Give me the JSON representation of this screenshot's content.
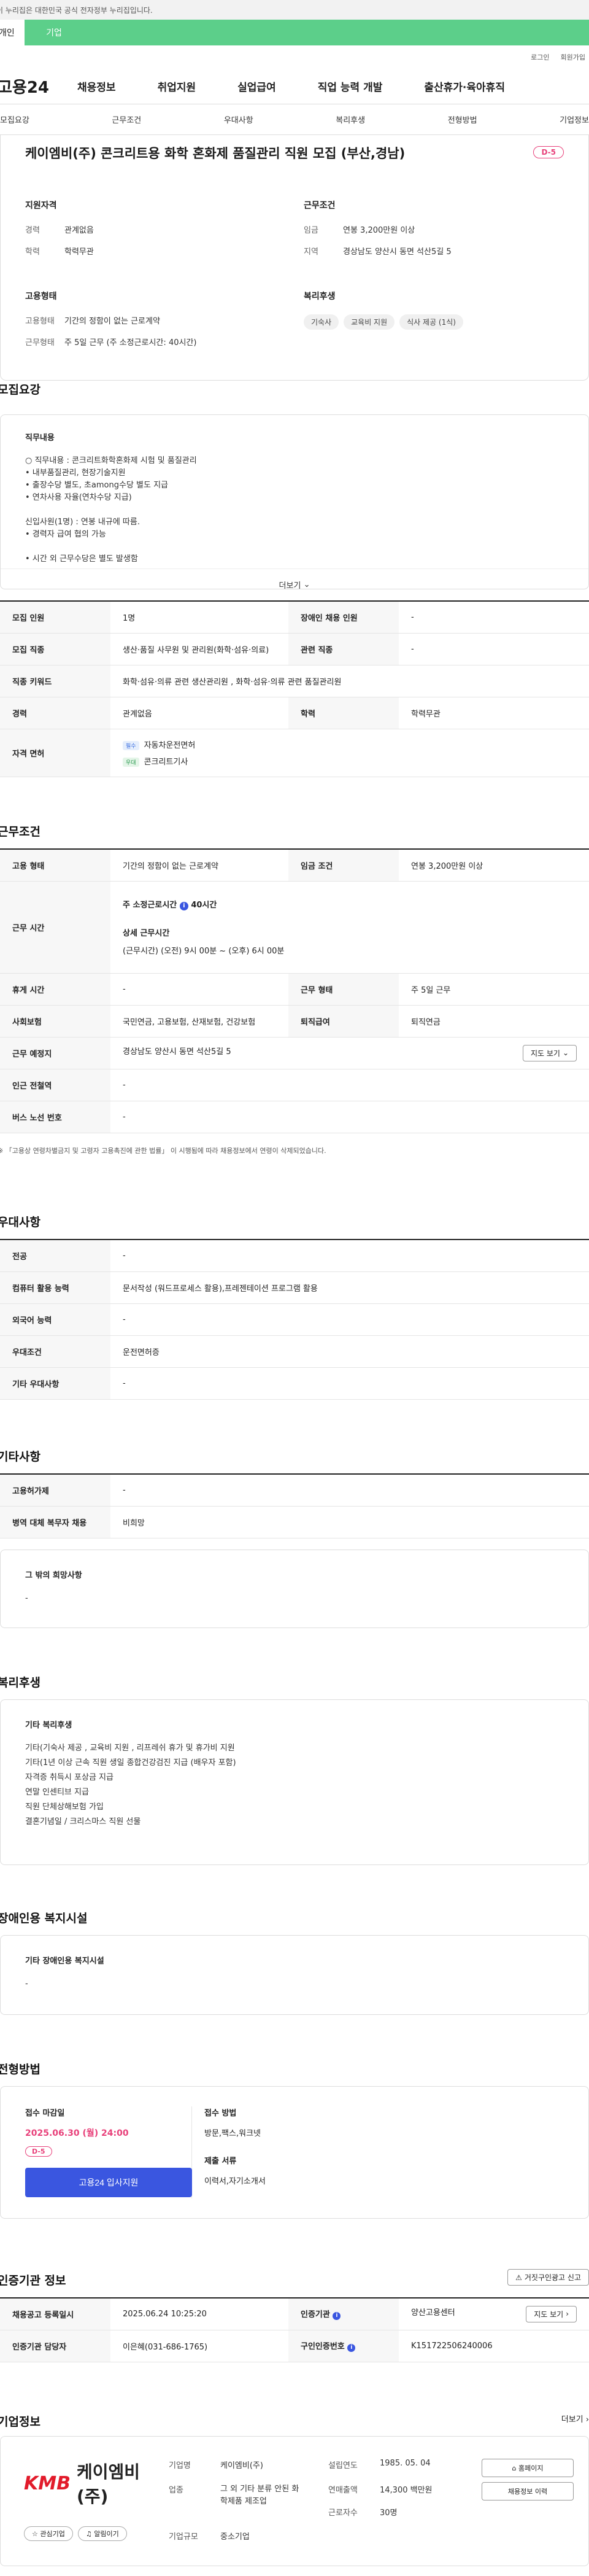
{
  "gov_banner": "이 누리집은 대한민국 공식 전자정부 누리집입니다.",
  "type_tabs": [
    "개인",
    "기업"
  ],
  "util_links": [
    "로그인",
    "회원가입"
  ],
  "logo": "고용24",
  "gnb": [
    "채용정보",
    "취업지원",
    "실업급여",
    "직업 능력 개발",
    "출산휴가·육아휴직"
  ],
  "subnav": [
    "모집요강",
    "근무조건",
    "우대사항",
    "복리후생",
    "전형방법",
    "기업정보"
  ],
  "job": {
    "title": "케이엠비(주) 콘크리트용 화학 혼화제 품질관리 직원 모집 (부산,경남)",
    "dday": "D-5",
    "qualification_heading": "지원자격",
    "career_k": "경력",
    "career_v": "관계없음",
    "edu_k": "학력",
    "edu_v": "학력무관",
    "work_heading": "근무조건",
    "wage_k": "임금",
    "wage_v": "연봉 3,200만원 이상",
    "region_k": "지역",
    "region_v": "경상남도 양산시 동면 석산5길 5",
    "employ_heading": "고용형태",
    "emp_type_k": "고용형태",
    "emp_type_v": "기간의 정함이 없는 근로계약",
    "emp_hours_k": "근무형태",
    "emp_hours_v": "주 5일 근무 (주 소정근로시간: 40시간)",
    "welfare_heading": "복리후생",
    "welfare_chips": [
      "기숙사",
      "교육비 지원",
      "식사 제공 (1식)"
    ]
  },
  "recruit": {
    "section": "모집요강",
    "detail_heading": "직무내용",
    "detail_text": "○ 직무내용 : 콘크리트화학혼화제 시험 및 품질관리\n  • 내부품질관리, 현장기술지원\n  • 출장수당 별도, 초among수당 별도 지급\n  • 연차사용 자율(연차수당 지급)\n\n신입사원(1명) : 연봉 내규에 따름.\n  • 경력자 급여 협의 가능\n\n  • 시간 외 근무수당은 별도 발생함",
    "more": "더보기",
    "rows": [
      {
        "k1": "모집 인원",
        "v1": "1명",
        "k2": "장애인 채용 인원",
        "v2": "-"
      },
      {
        "k1": "모집 직종",
        "v1": "생산·품질 사무원 및 관리원(화학·섬유·의료)",
        "k2": "관련 직종",
        "v2": "-"
      },
      {
        "k1": "직종 키워드",
        "v1": "화학·섬유·의류 관련 생산관리원 , 화학·섬유·의류 관련 품질관리원"
      },
      {
        "k1": "경력",
        "v1": "관계없음",
        "k2": "학력",
        "v2": "학력무관"
      }
    ],
    "license_k": "자격 면허",
    "licenses": [
      {
        "tag": "필수",
        "name": "자동차운전면허"
      },
      {
        "tag": "우대",
        "name": "콘크리트기사"
      }
    ]
  },
  "conditions": {
    "section": "근무조건",
    "emp_type_k": "고용 형태",
    "emp_type_v": "기간의 정함이 없는 근로계약",
    "wage_k": "임금 조건",
    "wage_v": "연봉 3,200만원 이상",
    "hours_k": "근무 시간",
    "hours_main": "주 소정근로시간",
    "hours_main_v": "40시간",
    "hours_detail_title": "상세 근무시간",
    "hours_detail_v": "(근무시간) (오전) 9시 00분 ~ (오후) 6시 00분",
    "holiday_k": "휴게 시간",
    "holiday_v": "-",
    "form_k": "근무 형태",
    "form_v": "주 5일 근무",
    "insurance_k": "사회보험",
    "insurance_v": "국민연금, 고용보험, 산재보험, 건강보험",
    "retire_k": "퇴직급여",
    "retire_v": "퇴직연금",
    "place_k": "근무 예정지",
    "place_v": "경상남도 양산시 동면 석산5길 5",
    "map_btn": "지도 보기",
    "subway_k": "인근 전철역",
    "subway_v": "-",
    "bus_k": "버스 노선 번호",
    "bus_v": "-",
    "note": "※ 「고용상 연령차별금지 및 고령자 고용촉진에 관한 법률」 이 시행됨에 따라 채용정보에서 연령이 삭제되었습니다."
  },
  "preference": {
    "section": "우대사항",
    "rows": [
      {
        "k": "전공",
        "v": "-"
      },
      {
        "k": "컴퓨터 활용 능력",
        "v": "문서작성 (워드프로세스 활용),프레젠테이션 프로그램 활용"
      },
      {
        "k": "외국어 능력",
        "v": "-"
      },
      {
        "k": "우대조건",
        "v": "운전면허증"
      },
      {
        "k": "기타 우대사항",
        "v": "-"
      }
    ]
  },
  "etc": {
    "section": "기타사항",
    "rows": [
      {
        "k": "고용허가제",
        "v": "-"
      },
      {
        "k": "병역 대체 복무자 채용",
        "v": "비희망"
      }
    ],
    "other_heading": "그 밖의 희망사항",
    "other_v": "-"
  },
  "welfare": {
    "section": "복리후생",
    "heading": "기타 복리후생",
    "text": "기타(기숙사 제공 , 교육비 지원 , 리프레쉬 휴가 및 휴가비 지원\n기타(1년 이상 근속 직원 생일 종합건강검진 지급 (배우자 포함)\n자격증 취득시 포상금 지급\n연말 인센티브 지급\n직원 단체상해보험 가입\n결혼기념일 / 크리스마스 직원 선물"
  },
  "disability": {
    "section": "장애인용 복지시설",
    "heading": "기타 장애인용 복지시설",
    "v": "-"
  },
  "apply": {
    "section": "전형방법",
    "deadline_heading": "접수 마감일",
    "deadline": "2025.06.30 (월) 24:00",
    "dday": "D-5",
    "apply_btn": "고용24 입사지원",
    "method_heading": "접수 방법",
    "method_v": "방문,팩스,워크넷",
    "docs_heading": "제출 서류",
    "docs_v": "이력서,자기소개서"
  },
  "agency": {
    "section": "인증기관 정보",
    "report_btn": "거짓구인광고 신고",
    "reg_k": "채용공고 등록일시",
    "reg_v": "2025.06.24 10:25:20",
    "org_k": "인증기관",
    "org_v": "양산고용센터",
    "map_btn": "지도 보기",
    "manager_k": "인증기관 담당자",
    "manager_v": "이은혜(031-686-1765)",
    "num_k": "구인인증번호",
    "num_v": "K151722506240006"
  },
  "company": {
    "section": "기업정보",
    "more": "더보기",
    "logo_mark": "KMB",
    "name": "케이엠비(주)",
    "fav_btn": "관심기업",
    "alert_btn": "알림이기",
    "corp_k": "기업명",
    "corp_v": "케이엠비(주)",
    "est_k": "설립연도",
    "est_v": "1985. 05. 04",
    "industry_k": "업종",
    "industry_v": "그 외 기타 분류 안된 화학제품 제조업",
    "sales_k": "연매출액",
    "sales_v": "14,300 백만원",
    "emp_k": "근로자수",
    "emp_v": "30명",
    "size_k": "기업규모",
    "size_v": "중소기업",
    "homepage_btn": "홈페이지",
    "history_btn": "채용정보 이력"
  }
}
